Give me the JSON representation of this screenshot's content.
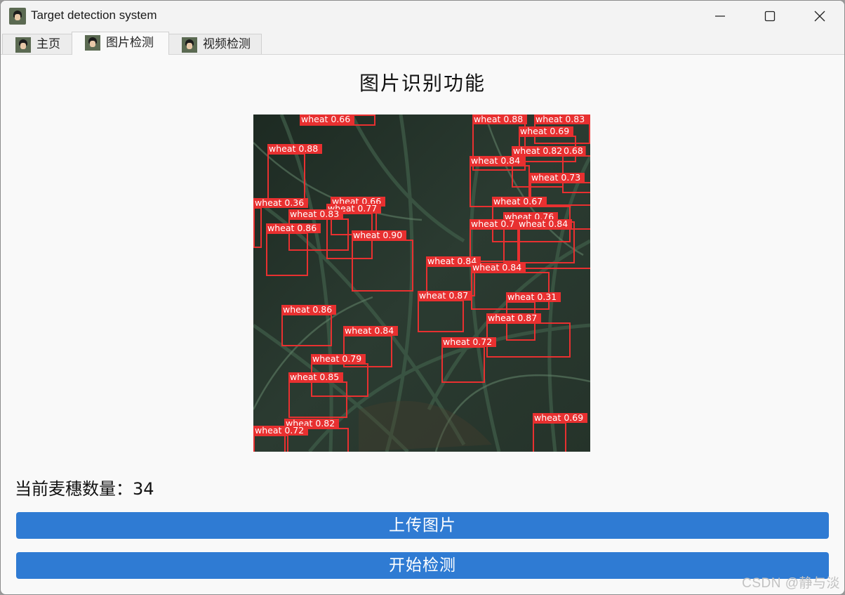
{
  "window": {
    "title": "Target detection system"
  },
  "tabs": [
    {
      "label": "主页",
      "active": false
    },
    {
      "label": "图片检测",
      "active": true
    },
    {
      "label": "视频检测",
      "active": false
    }
  ],
  "main": {
    "heading": "图片识别功能",
    "count_label": "当前麦穗数量：",
    "count_value": "34",
    "upload_button": "上传图片",
    "start_button": "开始检测"
  },
  "detections": [
    {
      "label": "wheat 0.66"
    },
    {
      "label": "wheat 0.88"
    },
    {
      "label": "wheat 0.83"
    },
    {
      "label": "wheat 0.88"
    },
    {
      "label": "wheat 0.69"
    },
    {
      "label": "wheat 0.82"
    },
    {
      "label": "0.68"
    },
    {
      "label": "wheat 0.84"
    },
    {
      "label": "wheat 0.73"
    },
    {
      "label": "wheat 0.36"
    },
    {
      "label": "wheat 0.66"
    },
    {
      "label": "wheat 0.77"
    },
    {
      "label": "wheat 0.83"
    },
    {
      "label": "wheat 0.67"
    },
    {
      "label": "wheat 0.86"
    },
    {
      "label": "wheat 0.90"
    },
    {
      "label": "wheat 0.76"
    },
    {
      "label": "wheat 0.7"
    },
    {
      "label": "wheat 0.84"
    },
    {
      "label": "wheat 0.84"
    },
    {
      "label": "wheat 0.84"
    },
    {
      "label": "wheat 0.87"
    },
    {
      "label": "wheat 0.31"
    },
    {
      "label": "wheat 0.86"
    },
    {
      "label": "wheat 0.87"
    },
    {
      "label": "wheat 0.84"
    },
    {
      "label": "wheat 0.72"
    },
    {
      "label": "wheat 0.79"
    },
    {
      "label": "wheat 0.85"
    },
    {
      "label": "wheat 0.82"
    },
    {
      "label": "wheat 0.72"
    },
    {
      "label": "wheat 0.69"
    }
  ],
  "watermark": "CSDN @静与淡",
  "colors": {
    "accent": "#2f7bd3",
    "box": "#e83030"
  }
}
